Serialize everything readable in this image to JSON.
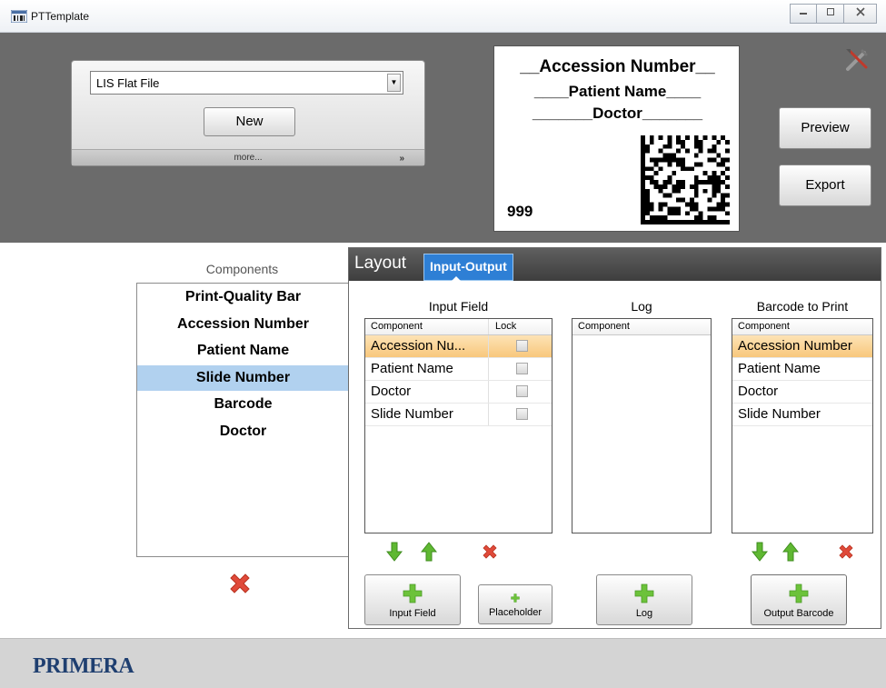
{
  "window": {
    "title": "PTTemplate",
    "controls": [
      "minimize",
      "maximize",
      "close"
    ]
  },
  "profile": {
    "selected": "LIS Flat File",
    "new_label": "New",
    "more_label": "more..."
  },
  "label_preview": {
    "line1": "__Accession Number__",
    "line2": "____Patient Name____",
    "line3": "_______Doctor_______",
    "number": "999"
  },
  "actions": {
    "preview_label": "Preview",
    "export_label": "Export"
  },
  "components": {
    "title": "Components",
    "items": [
      "Print-Quality Bar",
      "Accession Number",
      "Patient Name",
      "Slide Number",
      "Barcode",
      "Doctor"
    ],
    "selected_index": 3
  },
  "tabs": {
    "layout": "Layout",
    "input_output": "Input-Output",
    "active": "Input-Output"
  },
  "input_field": {
    "title": "Input Field",
    "headers": [
      "Component",
      "Lock"
    ],
    "rows": [
      {
        "name": "Accession Nu...",
        "locked": false
      },
      {
        "name": "Patient Name",
        "locked": false
      },
      {
        "name": "Doctor",
        "locked": false
      },
      {
        "name": "Slide Number",
        "locked": false
      }
    ],
    "selected_index": 0
  },
  "log": {
    "title": "Log",
    "headers": [
      "Component"
    ],
    "rows": []
  },
  "barcode_print": {
    "title": "Barcode to Print",
    "headers": [
      "Component"
    ],
    "rows": [
      "Accession Number",
      "Patient Name",
      "Doctor",
      "Slide Number"
    ],
    "selected_index": 0
  },
  "buttons": {
    "add_input": "Input Field",
    "placeholder": "Placeholder",
    "add_log": "Log",
    "output_barcode": "Output Barcode"
  },
  "footer": {
    "brand": "PRIMERA"
  },
  "colors": {
    "dark_panel": "#6b6b6b",
    "tab_active": "#2e7fd5",
    "selection_blue": "#b1d1ef",
    "selection_orange": "#f8c77c",
    "arrow_green": "#5fb832",
    "delete_red": "#e04a3a",
    "brand_navy": "#1f3f70"
  }
}
